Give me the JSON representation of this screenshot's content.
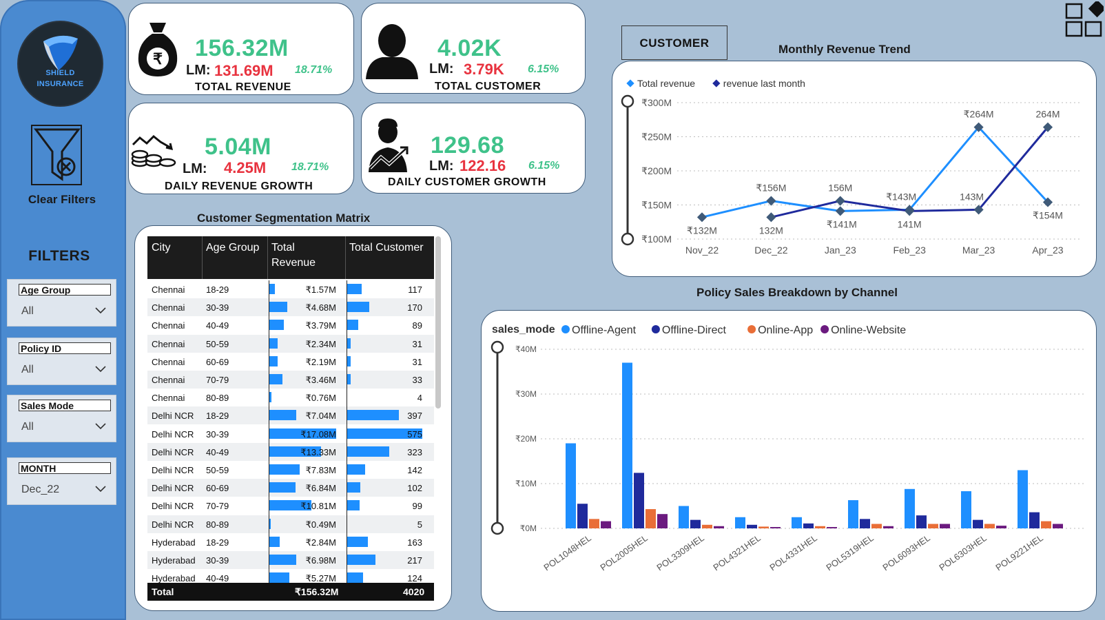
{
  "sidebar": {
    "logo_line1": "SHIELD",
    "logo_line2": "INSURANCE",
    "clear_filters": "Clear Filters",
    "filters_title": "FILTERS",
    "slicers": [
      {
        "header": "Age Group",
        "value": "All"
      },
      {
        "header": "Policy ID",
        "value": "All"
      },
      {
        "header": "Sales Mode",
        "value": "All"
      },
      {
        "header": "MONTH",
        "value": "Dec_22"
      }
    ]
  },
  "kpis": {
    "total_revenue": {
      "value": "156.32M",
      "lm_label": "LM:",
      "lm_value": "131.69M",
      "pct": "18.71%",
      "caption": "TOTAL REVENUE"
    },
    "total_customer": {
      "value": "4.02K",
      "lm_label": "LM:",
      "lm_value": "3.79K",
      "pct": "6.15%",
      "caption": "TOTAL CUSTOMER"
    },
    "daily_revenue": {
      "value": "5.04M",
      "lm_label": "LM:",
      "lm_value": "4.25M",
      "pct": "18.71%",
      "caption": "DAILY REVENUE GROWTH"
    },
    "daily_customer": {
      "value": "129.68",
      "lm_label": "LM:",
      "lm_value": "122.16",
      "pct": "6.15%",
      "caption": "DAILY CUSTOMER GROWTH"
    }
  },
  "customer_button": "CUSTOMER",
  "matrix": {
    "title": "Customer Segmentation Matrix",
    "columns": [
      "City",
      "Age Group",
      "Total\nRevenue",
      "Total Customer"
    ],
    "rows": [
      {
        "city": "Chennai",
        "age": "18-29",
        "revenue": "₹1.57M",
        "rev_num": 1.57,
        "customers": "117",
        "cust_num": 117
      },
      {
        "city": "Chennai",
        "age": "30-39",
        "revenue": "₹4.68M",
        "rev_num": 4.68,
        "customers": "170",
        "cust_num": 170
      },
      {
        "city": "Chennai",
        "age": "40-49",
        "revenue": "₹3.79M",
        "rev_num": 3.79,
        "customers": "89",
        "cust_num": 89
      },
      {
        "city": "Chennai",
        "age": "50-59",
        "revenue": "₹2.34M",
        "rev_num": 2.34,
        "customers": "31",
        "cust_num": 31
      },
      {
        "city": "Chennai",
        "age": "60-69",
        "revenue": "₹2.19M",
        "rev_num": 2.19,
        "customers": "31",
        "cust_num": 31
      },
      {
        "city": "Chennai",
        "age": "70-79",
        "revenue": "₹3.46M",
        "rev_num": 3.46,
        "customers": "33",
        "cust_num": 33
      },
      {
        "city": "Chennai",
        "age": "80-89",
        "revenue": "₹0.76M",
        "rev_num": 0.76,
        "customers": "4",
        "cust_num": 4
      },
      {
        "city": "Delhi NCR",
        "age": "18-29",
        "revenue": "₹7.04M",
        "rev_num": 7.04,
        "customers": "397",
        "cust_num": 397
      },
      {
        "city": "Delhi NCR",
        "age": "30-39",
        "revenue": "₹17.08M",
        "rev_num": 17.08,
        "customers": "575",
        "cust_num": 575
      },
      {
        "city": "Delhi NCR",
        "age": "40-49",
        "revenue": "₹13.33M",
        "rev_num": 13.33,
        "customers": "323",
        "cust_num": 323
      },
      {
        "city": "Delhi NCR",
        "age": "50-59",
        "revenue": "₹7.83M",
        "rev_num": 7.83,
        "customers": "142",
        "cust_num": 142
      },
      {
        "city": "Delhi NCR",
        "age": "60-69",
        "revenue": "₹6.84M",
        "rev_num": 6.84,
        "customers": "102",
        "cust_num": 102
      },
      {
        "city": "Delhi NCR",
        "age": "70-79",
        "revenue": "₹10.81M",
        "rev_num": 10.81,
        "customers": "99",
        "cust_num": 99
      },
      {
        "city": "Delhi NCR",
        "age": "80-89",
        "revenue": "₹0.49M",
        "rev_num": 0.49,
        "customers": "5",
        "cust_num": 5
      },
      {
        "city": "Hyderabad",
        "age": "18-29",
        "revenue": "₹2.84M",
        "rev_num": 2.84,
        "customers": "163",
        "cust_num": 163
      },
      {
        "city": "Hyderabad",
        "age": "30-39",
        "revenue": "₹6.98M",
        "rev_num": 6.98,
        "customers": "217",
        "cust_num": 217
      },
      {
        "city": "Hyderabad",
        "age": "40-49",
        "revenue": "₹5.27M",
        "rev_num": 5.27,
        "customers": "124",
        "cust_num": 124
      }
    ],
    "total": {
      "label": "Total",
      "revenue": "₹156.32M",
      "customers": "4020"
    }
  },
  "chart_data": [
    {
      "type": "line",
      "title": "Monthly Revenue Trend",
      "x": [
        "Nov_22",
        "Dec_22",
        "Jan_23",
        "Feb_23",
        "Mar_23",
        "Apr_23"
      ],
      "y_ticks": [
        "₹100M",
        "₹150M",
        "₹200M",
        "₹250M",
        "₹300M"
      ],
      "ylim": [
        100,
        300
      ],
      "legend_position": "top-left",
      "series": [
        {
          "name": "Total revenue",
          "color": "#1e8fff",
          "values": [
            132,
            156,
            141,
            143,
            264,
            154
          ],
          "labels": [
            "₹132M",
            "₹156M",
            "₹141M",
            "₹143M",
            "₹264M",
            "₹154M"
          ]
        },
        {
          "name": "revenue last month",
          "color": "#1f2a9c",
          "values": [
            null,
            132,
            156,
            141,
            143,
            264
          ],
          "labels": [
            "",
            "132M",
            "156M",
            "141M",
            "143M",
            "264M"
          ]
        }
      ]
    },
    {
      "type": "bar",
      "title": "Policy Sales Breakdown by Channel",
      "legend_title": "sales_mode",
      "categories": [
        "POL1048HEL",
        "POL2005HEL",
        "POL3309HEL",
        "POL4321HEL",
        "POL4331HEL",
        "POL5319HEL",
        "POL6093HEL",
        "POL6303HEL",
        "POL9221HEL"
      ],
      "y_ticks": [
        "₹0M",
        "₹10M",
        "₹20M",
        "₹30M",
        "₹40M"
      ],
      "ylim": [
        0,
        40
      ],
      "legend_position": "top-left",
      "series": [
        {
          "name": "Offline-Agent",
          "color": "#1e8fff",
          "values": [
            19,
            37,
            5,
            2.5,
            2.5,
            6.3,
            8.8,
            8.3,
            13
          ]
        },
        {
          "name": "Offline-Direct",
          "color": "#1f2a9c",
          "values": [
            5.5,
            12.4,
            1.9,
            0.8,
            1.1,
            2.1,
            2.9,
            1.9,
            3.6
          ]
        },
        {
          "name": "Online-App",
          "color": "#e96e37",
          "values": [
            2.1,
            4.3,
            0.8,
            0.4,
            0.5,
            1.0,
            1.0,
            1.0,
            1.6
          ]
        },
        {
          "name": "Online-Website",
          "color": "#6b1a7f",
          "values": [
            1.6,
            3.2,
            0.5,
            0.3,
            0.3,
            0.5,
            1.0,
            0.6,
            1.0
          ]
        }
      ]
    }
  ]
}
